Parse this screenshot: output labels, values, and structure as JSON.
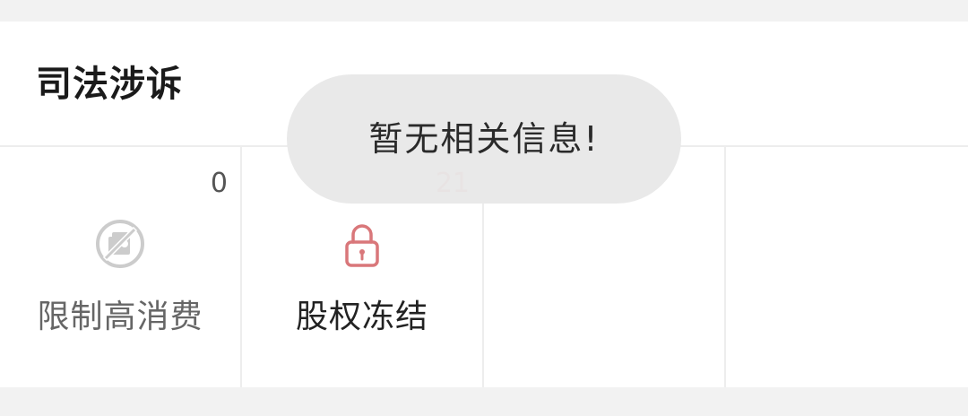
{
  "section": {
    "title": "司法涉诉"
  },
  "items": [
    {
      "label": "限制高消费",
      "count": "0",
      "icon": "restricted-consumption-icon",
      "color": "#cccccc"
    },
    {
      "label": "股权冻结",
      "count": "21",
      "icon": "lock-icon",
      "color": "#d9777a"
    }
  ],
  "toast": {
    "message": "暂无相关信息!"
  }
}
